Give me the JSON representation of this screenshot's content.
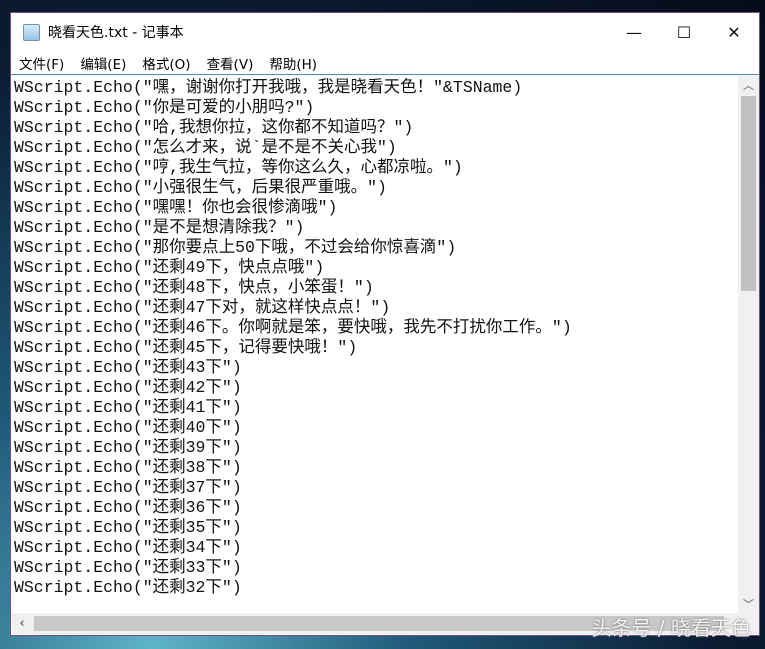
{
  "window": {
    "title": "晓看天色.txt - 记事本",
    "minimize": "—",
    "maximize": "☐",
    "close": "✕"
  },
  "menu": [
    "文件(F)",
    "编辑(E)",
    "格式(O)",
    "查看(V)",
    "帮助(H)"
  ],
  "lines": [
    "WScript.Echo(\"嘿，谢谢你打开我哦，我是晓看天色！\"&TSName)",
    "WScript.Echo(\"你是可爱的小朋吗?\")",
    "WScript.Echo(\"哈,我想你拉，这你都不知道吗？\")",
    "WScript.Echo(\"怎么才来，说`是不是不关心我\")",
    "WScript.Echo(\"哼,我生气拉，等你这么久，心都凉啦。\")",
    "WScript.Echo(\"小强很生气，后果很严重哦。\")",
    "WScript.Echo(\"嘿嘿！你也会很惨滴哦\")",
    "WScript.Echo(\"是不是想清除我？\")",
    "WScript.Echo(\"那你要点上50下哦，不过会给你惊喜滴\")",
    "WScript.Echo(\"还剩49下，快点点哦\")",
    "WScript.Echo(\"还剩48下，快点，小笨蛋！\")",
    "WScript.Echo(\"还剩47下对，就这样快点点！\")",
    "WScript.Echo(\"还剩46下。你啊就是笨，要快哦，我先不打扰你工作。\")",
    "WScript.Echo(\"还剩45下，记得要快哦！\")",
    "WScript.Echo(\"还剩43下\")",
    "WScript.Echo(\"还剩42下\")",
    "WScript.Echo(\"还剩41下\")",
    "WScript.Echo(\"还剩40下\")",
    "WScript.Echo(\"还剩39下\")",
    "WScript.Echo(\"还剩38下\")",
    "WScript.Echo(\"还剩37下\")",
    "WScript.Echo(\"还剩36下\")",
    "WScript.Echo(\"还剩35下\")",
    "WScript.Echo(\"还剩34下\")",
    "WScript.Echo(\"还剩33下\")",
    "WScript.Echo(\"还剩32下\")"
  ],
  "scroll": {
    "up": "︿",
    "down": "﹀",
    "left": "‹"
  },
  "watermark": "头条号 / 晓看天色"
}
